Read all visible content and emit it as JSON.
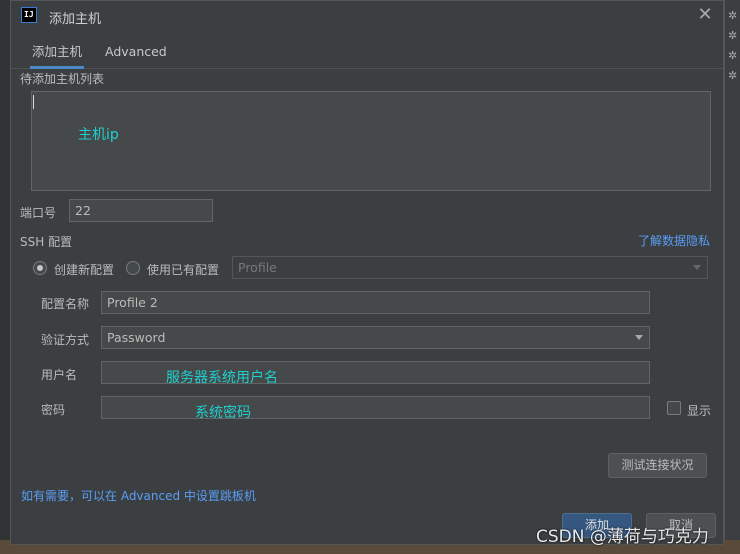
{
  "dialog": {
    "title": "添加主机",
    "close_glyph": "✕"
  },
  "tabs": [
    {
      "label": "添加主机",
      "active": true
    },
    {
      "label": "Advanced",
      "active": false
    }
  ],
  "host_list": {
    "label": "待添加主机列表",
    "value": "",
    "annotation": "主机ip"
  },
  "port": {
    "label": "端口号",
    "value": "22"
  },
  "ssh": {
    "label": "SSH 配置",
    "privacy_link": "了解数据隐私",
    "option_new": "创建新配置",
    "option_existing": "使用已有配置",
    "selected": "option_new",
    "profile_select": "Profile"
  },
  "config": {
    "name_label": "配置名称",
    "name_value": "Profile 2",
    "auth_label": "验证方式",
    "auth_value": "Password",
    "user_label": "用户名",
    "user_value": "",
    "user_annotation": "服务器系统用户名",
    "password_label": "密码",
    "password_value": "",
    "password_annotation": "系统密码",
    "show_label": "显示",
    "show_checked": false
  },
  "buttons": {
    "test_connection": "测试连接状况",
    "add": "添加",
    "cancel": "取消"
  },
  "footer": {
    "hint": "如有需要，可以在 Advanced 中设置跳板机"
  },
  "watermark": "CSDN @薄荷与巧克力",
  "colors": {
    "accent": "#4a88c7",
    "link": "#589df6",
    "annotation": "#1fd0d0",
    "background": "#3c3f41"
  }
}
